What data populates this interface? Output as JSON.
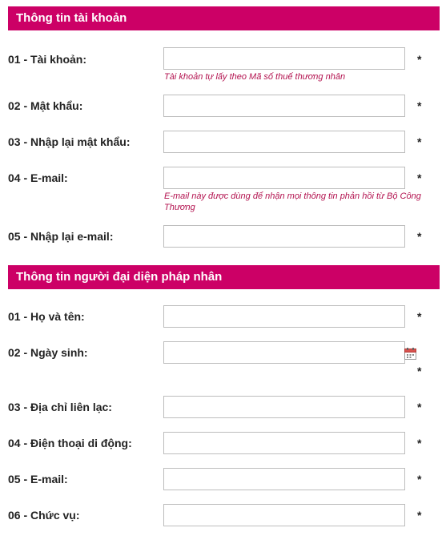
{
  "account_section": {
    "title": "Thông tin tài khoản",
    "fields": [
      {
        "label": "01 - Tài khoản:",
        "value": "",
        "required": "*",
        "hint": "Tài khoản tự lấy theo Mã số thuế thương nhân"
      },
      {
        "label": "02 - Mật khẩu:",
        "value": "",
        "required": "*"
      },
      {
        "label": "03 - Nhập lại mật khẩu:",
        "value": "",
        "required": "*"
      },
      {
        "label": "04 - E-mail:",
        "value": "",
        "required": "*",
        "hint": "E-mail này được dùng để nhận mọi thông tin phản hồi từ Bộ Công Thương"
      },
      {
        "label": "05 - Nhập lại e-mail:",
        "value": "",
        "required": "*"
      }
    ]
  },
  "representative_section": {
    "title": "Thông tin người đại diện pháp nhân",
    "fields": [
      {
        "label": "01 - Họ và tên:",
        "value": "",
        "required": "*"
      },
      {
        "label": "02 - Ngày sinh:",
        "value": "",
        "required": "*",
        "icon": "calendar-icon"
      },
      {
        "label": "03 - Địa chỉ liên lạc:",
        "value": "",
        "required": "*"
      },
      {
        "label": "04 - Điện thoại di động:",
        "value": "",
        "required": "*"
      },
      {
        "label": "05 - E-mail:",
        "value": "",
        "required": "*"
      },
      {
        "label": "06 - Chức vụ:",
        "value": "",
        "required": "*"
      }
    ]
  },
  "colors": {
    "header_bg": "#cc0066",
    "hint_text": "#b3124f"
  }
}
